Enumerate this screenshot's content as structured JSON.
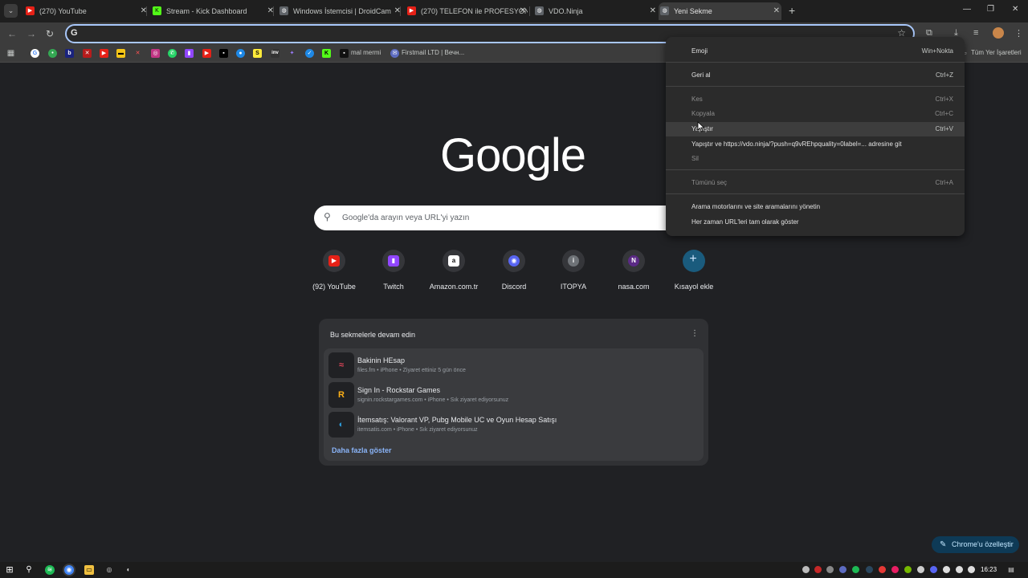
{
  "tabs": [
    {
      "title": "(270) YouTube",
      "fav_color": "#e62117",
      "fav_glyph": "▶"
    },
    {
      "title": "Stream - Kick Dashboard",
      "fav_color": "#53fc18",
      "fav_glyph": "K"
    },
    {
      "title": "Windows İstemcisi | DroidCam",
      "fav_color": "#5f6368",
      "fav_glyph": "◍"
    },
    {
      "title": "(270) TELEFON ile PROFESYONE",
      "fav_color": "#e62117",
      "fav_glyph": "▶"
    },
    {
      "title": "VDO.Ninja",
      "fav_color": "#5f6368",
      "fav_glyph": "◍"
    },
    {
      "title": "Yeni Sekme",
      "fav_color": "#5f6368",
      "fav_glyph": "◍"
    }
  ],
  "omnibox": {
    "value": "",
    "g_glyph": "G"
  },
  "bookmarks": {
    "mal_mermi": "mal mermi",
    "firstmail": "Firstmail LTD | Вечн...",
    "all_bookmarks": "Tüm Yer İşaretleri"
  },
  "logo": "Google",
  "search": {
    "placeholder": "Google'da arayın veya URL'yi yazın"
  },
  "shortcuts": [
    {
      "label": "(92) YouTube",
      "glyph": "▶",
      "color": "#e62117"
    },
    {
      "label": "Twitch",
      "glyph": "▮",
      "color": "#9146ff"
    },
    {
      "label": "Amazon.com.tr",
      "glyph": "a",
      "color": "#111"
    },
    {
      "label": "Discord",
      "glyph": "◉",
      "color": "#5865f2"
    },
    {
      "label": "ITOPYA",
      "glyph": "i",
      "color": "#6f7378"
    },
    {
      "label": "nasa.com",
      "glyph": "N",
      "color": "#5b2a86"
    },
    {
      "label": "Kısayol ekle",
      "glyph": "+",
      "color": ""
    }
  ],
  "resume": {
    "header": "Bu sekmelerle devam edin",
    "items": [
      {
        "title": "Bakinin HEsap",
        "sub": "files.fm • iPhone • Ziyaret ettiniz 5 gün önce",
        "glyph": "≈",
        "color": "#e2465a"
      },
      {
        "title": "Sign In - Rockstar Games",
        "sub": "signin.rockstargames.com • iPhone • Sık ziyaret ediyorsunuz",
        "glyph": "R",
        "color": "#fcaf17"
      },
      {
        "title": "İtemsatış: Valorant VP, Pubg Mobile UC ve Oyun Hesap Satışı",
        "sub": "itemsatis.com • iPhone • Sık ziyaret ediyorsunuz",
        "glyph": "◐",
        "color": "#2d9cdb"
      }
    ],
    "show_more": "Daha fazla göster"
  },
  "context_menu": {
    "emoji": {
      "label": "Emoji",
      "key": "Win+Nokta"
    },
    "undo": {
      "label": "Geri al",
      "key": "Ctrl+Z"
    },
    "cut": {
      "label": "Kes",
      "key": "Ctrl+X"
    },
    "copy": {
      "label": "Kopyala",
      "key": "Ctrl+C"
    },
    "paste": {
      "label": "Yapıştır",
      "key": "Ctrl+V"
    },
    "paste_go": {
      "label": "Yapıştır ve https://vdo.ninja/?push=q9vREhpquality=0label=... adresine git",
      "key": ""
    },
    "delete": {
      "label": "Sil",
      "key": ""
    },
    "select_all": {
      "label": "Tümünü seç",
      "key": "Ctrl+A"
    },
    "manage_search": {
      "label": "Arama motorlarını ve site aramalarını yönetin",
      "key": ""
    },
    "show_urls": {
      "label": "Her zaman URL'leri tam olarak göster",
      "key": ""
    }
  },
  "customize": "Chrome'u özelleştir",
  "clock": "16:23"
}
